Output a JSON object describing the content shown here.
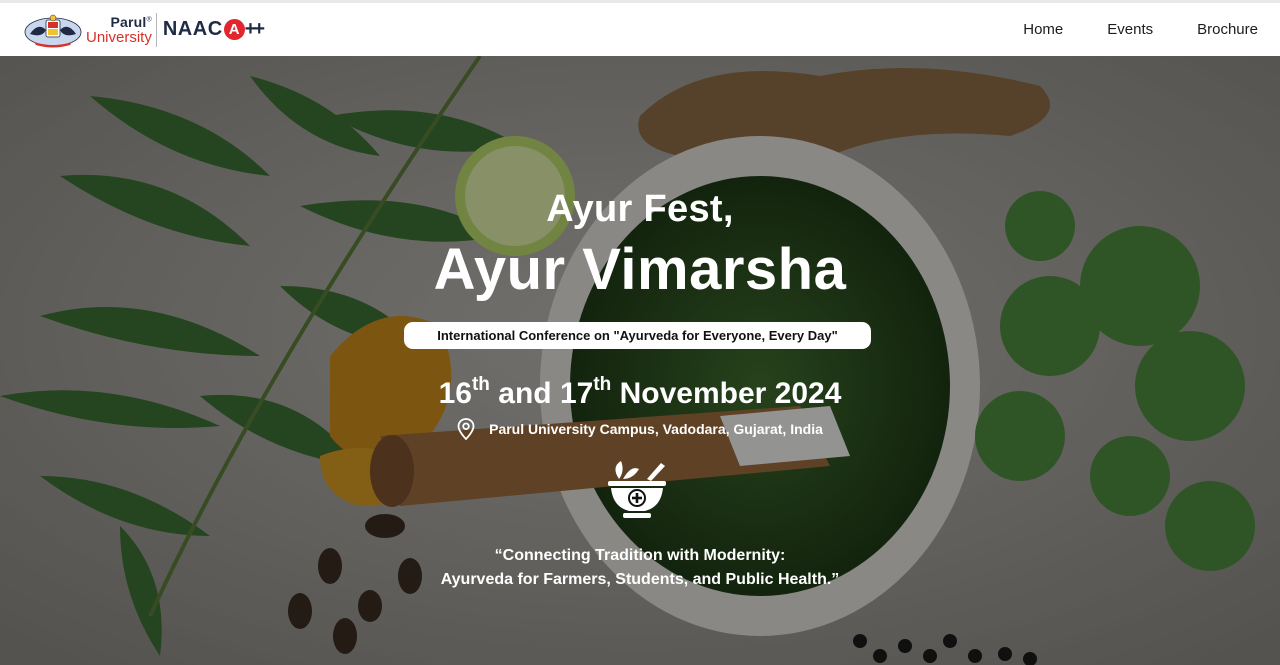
{
  "header": {
    "brand": {
      "parul": "Parul",
      "parul_mark": "®",
      "university": "University",
      "naac": "NAAC",
      "naac_grade_letter": "A",
      "naac_grade_plus": "++"
    },
    "nav": [
      {
        "label": "Home"
      },
      {
        "label": "Events"
      },
      {
        "label": "Brochure"
      }
    ]
  },
  "hero": {
    "title_line1": "Ayur Fest,",
    "title_line2": "Ayur Vimarsha",
    "subtitle": "International Conference on \"Ayurveda for Everyone, Every Day\"",
    "dates": {
      "day1": "16",
      "day1_suffix": "th",
      "conjunction": " and ",
      "day2": "17",
      "day2_suffix": "th",
      "month_year": " November 2024"
    },
    "venue": "Parul University Campus, Vadodara, Gujarat, India",
    "tagline_line1": "“Connecting Tradition with Modernity:",
    "tagline_line2": "Ayurveda for Farmers, Students, and Public Health.”"
  },
  "icons": {
    "venue": "location-pin-icon",
    "emblem": "mortar-pestle-icon",
    "crest": "university-crest-icon"
  },
  "colors": {
    "brand_navy": "#1f2a44",
    "brand_red": "#d6312a",
    "naac_red": "#e2262e",
    "hero_text": "#ffffff",
    "pill_bg": "#ffffff"
  }
}
